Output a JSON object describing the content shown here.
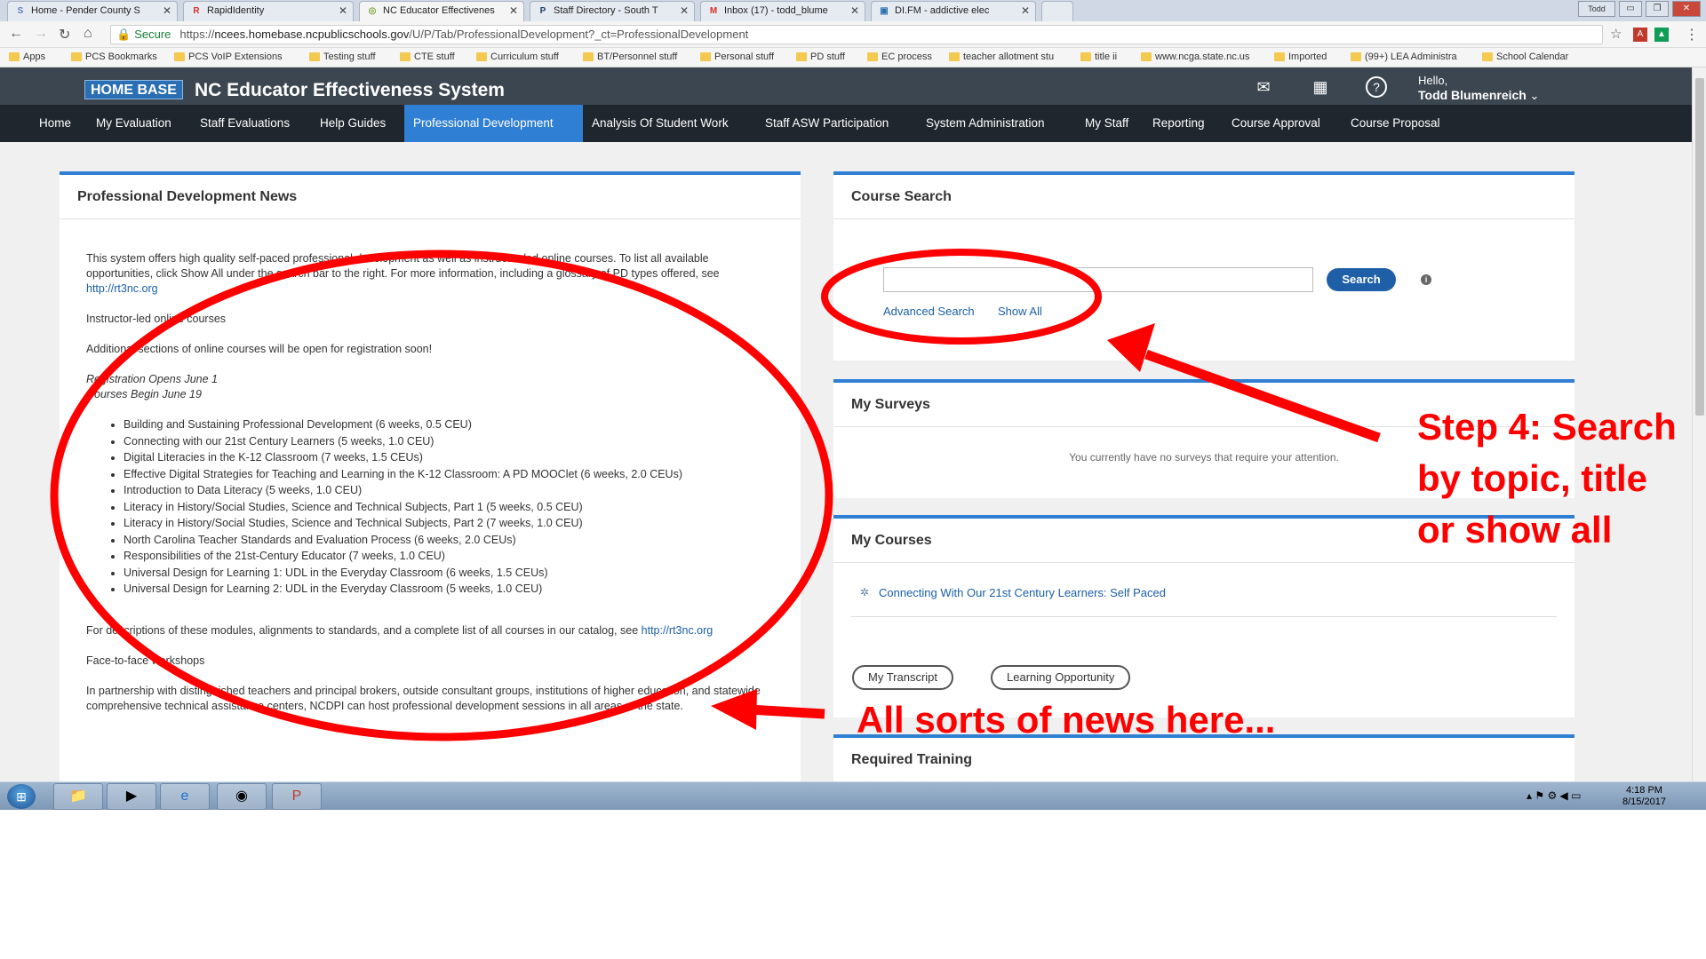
{
  "browser": {
    "tabs": [
      {
        "label": "Home - Pender County S",
        "fav": "S",
        "color": "#5e7dbf"
      },
      {
        "label": "RapidIdentity",
        "fav": "R",
        "color": "#d9322c"
      },
      {
        "label": "NC Educator Effectivenes",
        "fav": "◎",
        "color": "#7aa63c"
      },
      {
        "label": "Staff Directory - South T",
        "fav": "P",
        "color": "#1e3f66"
      },
      {
        "label": "Inbox (17) - todd_blume",
        "fav": "M",
        "color": "#d93025"
      },
      {
        "label": "DI.FM - addictive elec",
        "fav": "▣",
        "color": "#2a6fb3"
      }
    ],
    "user_badge": "Todd",
    "url": {
      "secure_label": "Secure",
      "prefix": "https://",
      "host": "ncees.homebase.ncpublicschools.gov",
      "path": "/U/P/Tab/ProfessionalDevelopment?_ct=ProfessionalDevelopment"
    },
    "bookmarks": [
      "Apps",
      "PCS Bookmarks",
      "PCS VoIP Extensions",
      "Testing stuff",
      "CTE stuff",
      "Curriculum stuff",
      "BT/Personnel stuff",
      "Personal stuff",
      "PD stuff",
      "EC process",
      "teacher allotment stu",
      "title ii",
      "www.ncga.state.nc.us",
      "Imported",
      "(99+) LEA Administra",
      "School Calendar"
    ]
  },
  "header": {
    "logo": "HOME BASE",
    "title": "NC Educator Effectiveness System",
    "hello": "Hello,",
    "user": "Todd Blumenreich"
  },
  "nav": [
    "Home",
    "My Evaluation",
    "Staff Evaluations",
    "Help Guides",
    "Professional Development",
    "Analysis Of Student Work",
    "Staff ASW Participation",
    "System Administration",
    "My Staff",
    "Reporting",
    "Course Approval",
    "Course Proposal"
  ],
  "news": {
    "title": "Professional Development News",
    "intro": "This system offers high quality self-paced professional development as well as instructor-led online courses. To list all available opportunities, click Show All under the search bar to the right. For more information, including a glossary of PD types offered, see",
    "intro_link": "http://rt3nc.org",
    "instructor": "Instructor-led online courses",
    "additional": "Additional sections of online courses will be open for registration soon!",
    "reg_open": "Registration Opens June 1",
    "courses_begin": "Courses Begin June 19",
    "courses": [
      "Building and Sustaining Professional Development (6 weeks, 0.5 CEU)",
      "Connecting with our 21st Century Learners (5 weeks, 1.0 CEU)",
      "Digital Literacies in the K-12 Classroom (7 weeks, 1.5 CEUs)",
      "Effective Digital Strategies for Teaching and Learning in the K-12 Classroom: A PD MOOClet (6 weeks, 2.0 CEUs)",
      "Introduction to Data Literacy (5 weeks, 1.0 CEU)",
      "Literacy in History/Social Studies, Science and Technical Subjects, Part 1 (5 weeks, 0.5 CEU)",
      "Literacy in History/Social Studies, Science and Technical Subjects, Part 2 (7 weeks, 1.0 CEU)",
      "North Carolina Teacher Standards and Evaluation Process (6 weeks, 2.0 CEUs)",
      "Responsibilities of the 21st-Century Educator (7 weeks, 1.0 CEU)",
      "Universal Design for Learning 1: UDL in the Everyday Classroom (6 weeks, 1.5 CEUs)",
      "Universal Design for Learning 2: UDL in the Everyday Classroom (5 weeks, 1.0 CEU)"
    ],
    "descriptions": "For descriptions of these modules, alignments to standards, and a complete list of all courses in our catalog, see",
    "descriptions_link": "http://rt3nc.org",
    "f2f": "Face-to-face workshops",
    "partnership": "In partnership with distinguished teachers and principal brokers, outside consultant groups, institutions of higher education, and statewide comprehensive technical assistance centers, NCDPI can host professional development sessions in all areas of the state."
  },
  "course_search": {
    "title": "Course Search",
    "search_value": "",
    "search_button": "Search",
    "advanced": "Advanced Search",
    "show_all": "Show All"
  },
  "surveys": {
    "title": "My Surveys",
    "empty": "You currently have no surveys that require your attention."
  },
  "my_courses": {
    "title": "My Courses",
    "course": "Connecting With Our 21st Century Learners: Self Paced",
    "transcript": "My Transcript",
    "learning": "Learning Opportunity"
  },
  "required": {
    "title": "Required Training"
  },
  "taskbar": {
    "time": "4:18 PM",
    "date": "8/15/2017"
  },
  "annotations": {
    "step4": [
      "Step 4: Search",
      "by topic, title",
      "or show all"
    ],
    "news_note": "All sorts of news here...",
    "color": "#ff0000"
  }
}
